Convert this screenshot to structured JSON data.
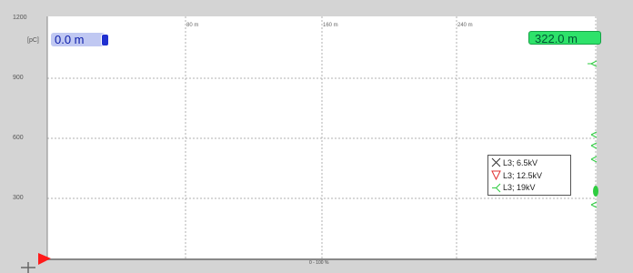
{
  "chart_data": {
    "type": "scatter",
    "y_axis": {
      "ticks": [
        "1200",
        "900",
        "600",
        "300"
      ],
      "unit": "[pC]",
      "ylim": [
        0,
        1200
      ]
    },
    "x_axis": {
      "tick_labels": [
        "80 m",
        "160 m",
        "240 m"
      ]
    },
    "cursors": {
      "left_label": "0.0 m",
      "right_label": "322.0 m"
    },
    "legend": [
      {
        "label": "L3; 6.5kV",
        "symbol": "x-icon",
        "color": "#333333"
      },
      {
        "label": "L3; 12.5kV",
        "symbol": "triangle-down-icon",
        "color": "#e03030"
      },
      {
        "label": "L3; 19kV",
        "symbol": "tri-star-icon",
        "color": "#2ecc40"
      }
    ],
    "scale_label": "0 - 100 %"
  }
}
